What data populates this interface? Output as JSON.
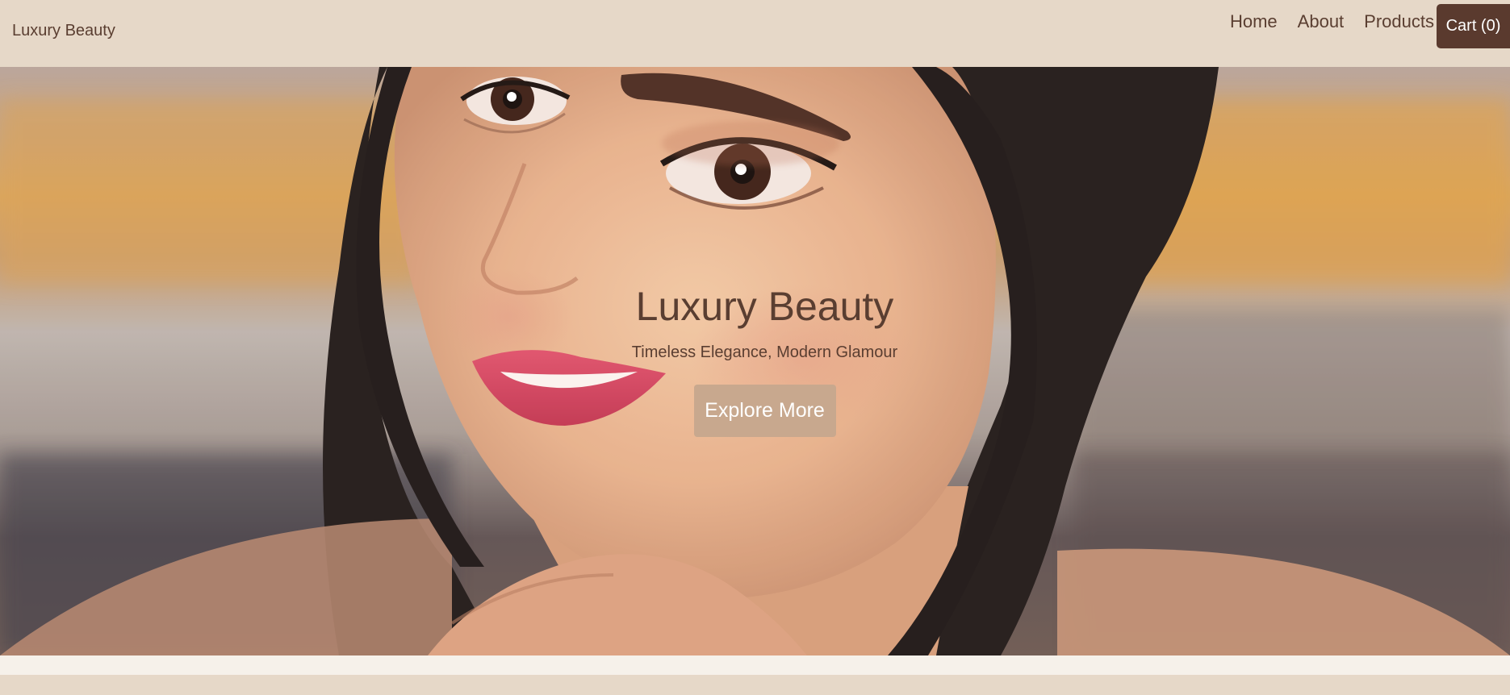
{
  "navbar": {
    "brand": "Luxury Beauty",
    "links": [
      "Home",
      "About",
      "Products"
    ],
    "cart_label": "Cart (0)"
  },
  "hero": {
    "title": "Luxury Beauty",
    "tagline": "Timeless Elegance, Modern Glamour",
    "cta_label": "Explore More"
  },
  "colors": {
    "brown": "#5a3e31",
    "nav_bg": "#e6d8c8",
    "cart_bg": "#5a3a2e",
    "cta_bg": "#c8a88e",
    "page_bg": "#f6f1ea"
  }
}
